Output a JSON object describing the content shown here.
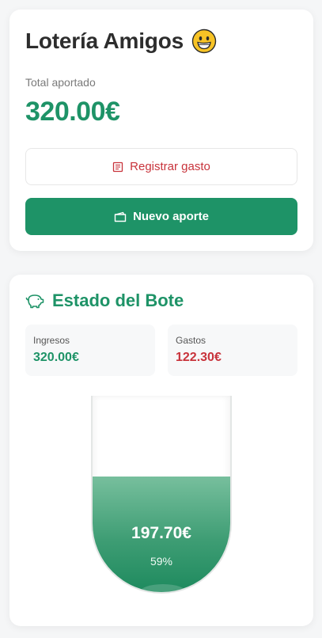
{
  "header": {
    "title": "Lotería Amigos",
    "emoji_icon": "grinning-face-icon",
    "total_label": "Total aportado",
    "total_value": "320.00€"
  },
  "actions": {
    "register_expense_label": "Registrar gasto",
    "register_expense_icon": "receipt-icon",
    "new_contribution_label": "Nuevo aporte",
    "new_contribution_icon": "wallet-icon"
  },
  "pot": {
    "title": "Estado del Bote",
    "icon": "piggy-bank-icon",
    "income_label": "Ingresos",
    "income_value": "320.00€",
    "expenses_label": "Gastos",
    "expenses_value": "122.30€",
    "balance": "197.70€",
    "fill_percent_label": "59%",
    "fill_fraction": 0.59
  },
  "colors": {
    "accent": "#1e9367",
    "danger": "#c8333b",
    "background": "#f5f6f7"
  }
}
